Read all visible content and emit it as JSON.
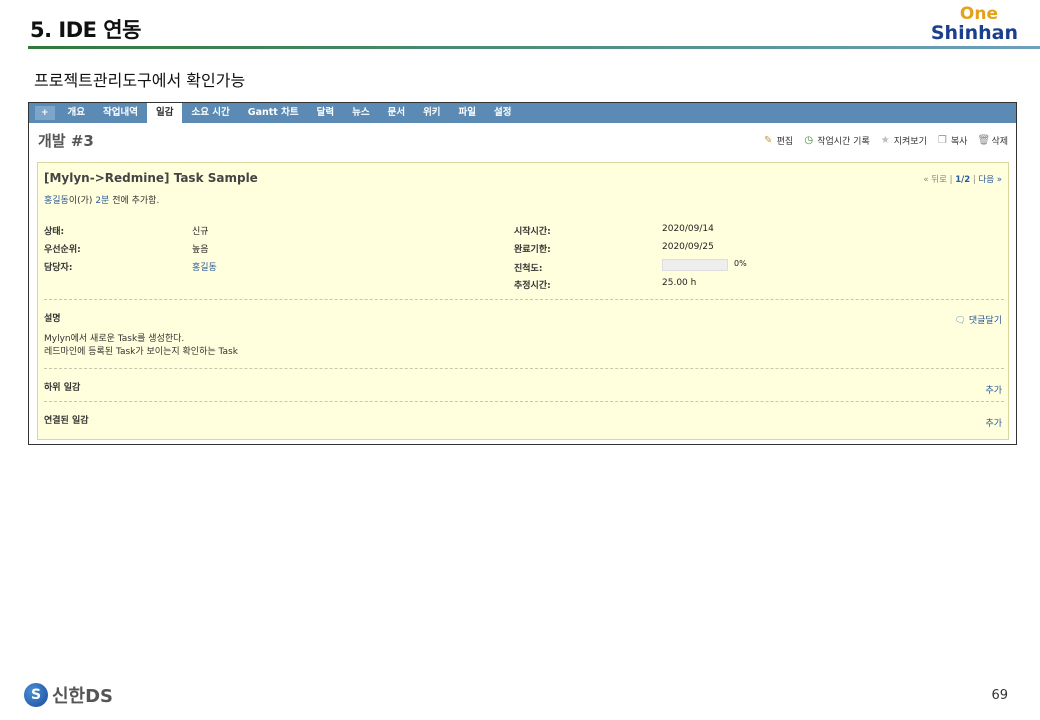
{
  "slide": {
    "title": "5. IDE 연동",
    "brand_top": "One",
    "brand_bottom": "Shinhan",
    "subtitle": "프로젝트관리도구에서 확인가능",
    "footer_logo_text": "신한DS",
    "page_number": "69"
  },
  "menu": {
    "items": [
      "+",
      "개요",
      "작업내역",
      "일감",
      "소요 시간",
      "Gantt 차트",
      "달력",
      "뉴스",
      "문서",
      "위키",
      "파일",
      "설정"
    ],
    "selected": "일감"
  },
  "issue": {
    "title": "개발 #3",
    "actions": [
      {
        "label": "편집",
        "icon": "pencil-icon"
      },
      {
        "label": "작업시간 기록",
        "icon": "time-add-icon"
      },
      {
        "label": "지켜보기",
        "icon": "star-icon"
      },
      {
        "label": "복사",
        "icon": "copy-icon"
      },
      {
        "label": "삭제",
        "icon": "trash-icon"
      }
    ],
    "subject": "[Mylyn->Redmine] Task Sample",
    "pager": {
      "prev": "« 뒤로",
      "sep": "|",
      "position": "1/2",
      "next": "다음 »"
    },
    "author": "홍길동",
    "author_suffix": "이(가)",
    "time_ago": "2분",
    "added_suffix": "전에 추가함.",
    "attributes": {
      "status_label": "상태:",
      "status_value": "신규",
      "priority_label": "우선순위:",
      "priority_value": "높음",
      "assignee_label": "담당자:",
      "assignee_value": "홍길동",
      "start_label": "시작시간:",
      "start_value": "2020/09/14",
      "due_label": "완료기한:",
      "due_value": "2020/09/25",
      "progress_label": "진척도:",
      "progress_value": "0%",
      "progress_fraction": 0,
      "estimate_label": "추정시간:",
      "estimate_value": "25.00 h"
    },
    "description_title": "설명",
    "quote_label": "댓글달기",
    "description_lines": [
      "Mylyn에서 새로운 Task를 생성한다.",
      "레드마인에 등록된 Task가 보이는지 확인하는 Task"
    ],
    "subtasks_title": "하위 일감",
    "subtasks_add": "추가",
    "related_title": "연결된 일감",
    "related_add": "추가"
  },
  "colors": {
    "menu_bar": "#5b8bb4",
    "issue_background": "#ffffdd",
    "link": "#2a5a9b",
    "brand_orange": "#e3a21a",
    "brand_blue": "#1a3f8c"
  }
}
